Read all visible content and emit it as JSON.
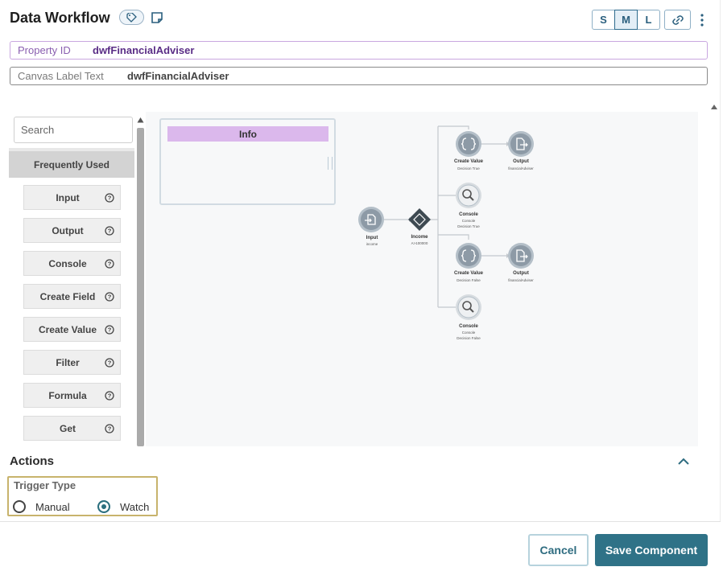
{
  "header": {
    "title": "Data Workflow",
    "size_options": [
      "S",
      "M",
      "L"
    ],
    "active_size": "M",
    "icons": {
      "tag": "tag-icon",
      "note": "note-icon",
      "link": "link-icon",
      "more": "more-vertical-icon"
    }
  },
  "fields": {
    "property_id": {
      "label": "Property ID",
      "value": "dwfFinancialAdviser"
    },
    "canvas_label": {
      "label": "Canvas Label Text",
      "value": "dwfFinancialAdviser"
    }
  },
  "palette": {
    "search_placeholder": "Search",
    "section": "Frequently Used",
    "items": [
      {
        "label": "Input"
      },
      {
        "label": "Output"
      },
      {
        "label": "Console"
      },
      {
        "label": "Create Field"
      },
      {
        "label": "Create Value"
      },
      {
        "label": "Filter"
      },
      {
        "label": "Formula"
      },
      {
        "label": "Get"
      }
    ]
  },
  "canvas": {
    "info_title": "Info",
    "nodes": {
      "input": {
        "label": "Input",
        "sub": "income"
      },
      "decision": {
        "label": "Income",
        "sub": "A>100000"
      },
      "cv_true": {
        "label": "Create Value",
        "sub": "Decision True"
      },
      "out_true": {
        "label": "Output",
        "sub": "financialAdviser"
      },
      "con_true": {
        "label": "Console",
        "sub": "Console",
        "sub2": "Decision True"
      },
      "cv_false": {
        "label": "Create Value",
        "sub": "Decision False"
      },
      "out_false": {
        "label": "Output",
        "sub": "financialAdviser"
      },
      "con_false": {
        "label": "Console",
        "sub": "Console",
        "sub2": "Decision False"
      }
    }
  },
  "actions": {
    "title": "Actions",
    "trigger_type": {
      "label": "Trigger Type",
      "options": [
        "Manual",
        "Watch"
      ],
      "selected": "Watch"
    }
  },
  "footer": {
    "cancel": "Cancel",
    "save": "Save Component"
  },
  "colors": {
    "accent": "#2f7287",
    "info_header": "#dbb8ec",
    "property_border": "#c9a7e0",
    "trigger_border": "#c8b36c",
    "node_fill": "#8d9aa6",
    "decision_fill": "#3e4a52"
  }
}
